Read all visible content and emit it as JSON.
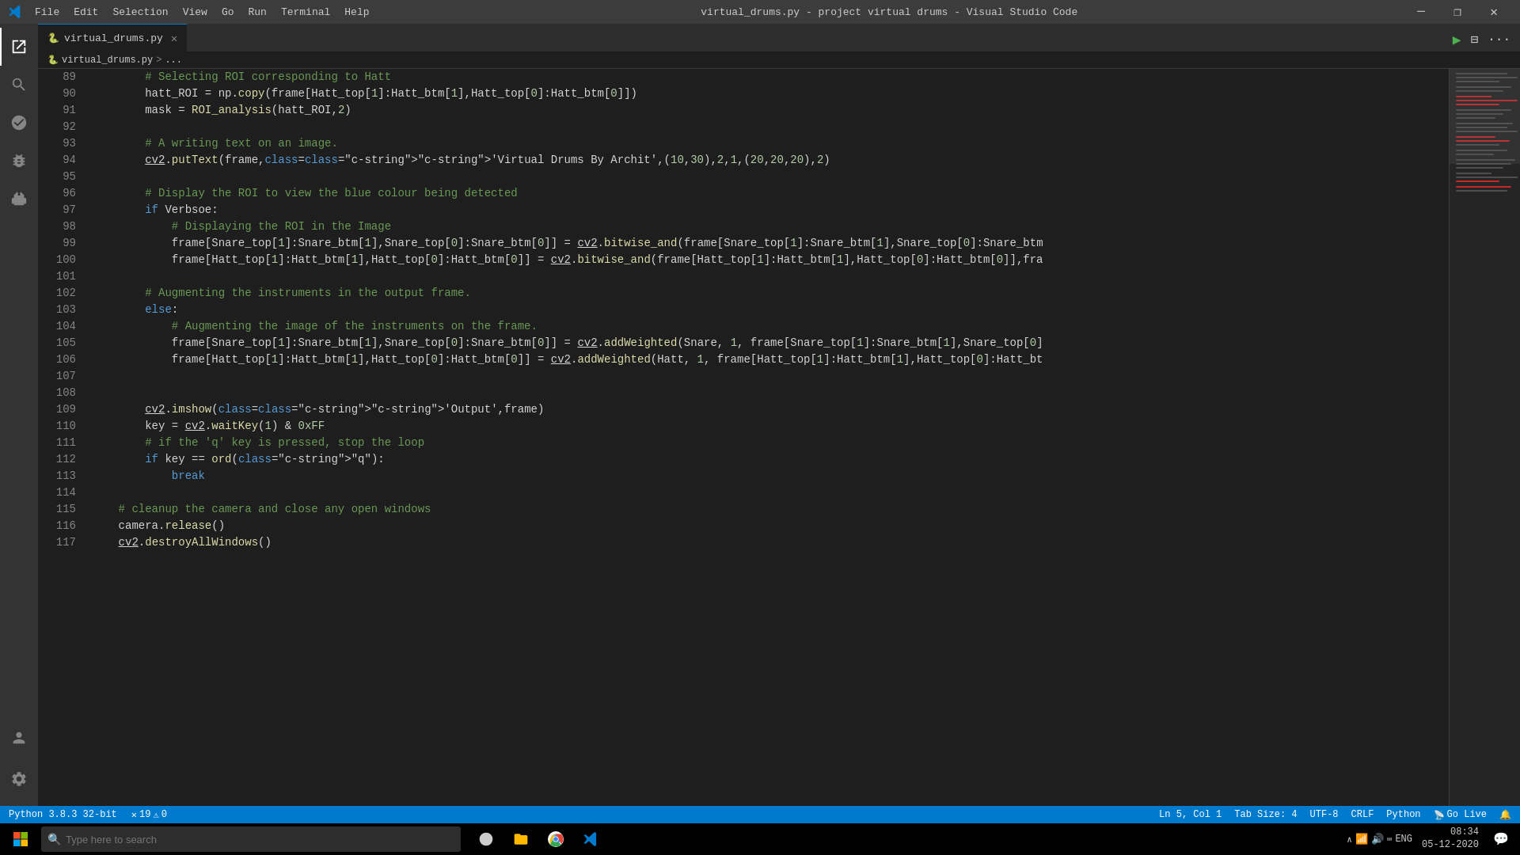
{
  "titlebar": {
    "title": "virtual_drums.py - project virtual drums - Visual Studio Code",
    "menu": [
      "File",
      "Edit",
      "Selection",
      "View",
      "Go",
      "Run",
      "Terminal",
      "Help"
    ]
  },
  "tab": {
    "filename": "virtual_drums.py",
    "icon": "🐍"
  },
  "breadcrumb": {
    "file": "virtual_drums.py",
    "sep": ">",
    "location": "..."
  },
  "lines": [
    {
      "num": "89",
      "code": "        # Selecting ROI corresponding to Hatt"
    },
    {
      "num": "90",
      "code": "        hatt_ROI = np.copy(frame[Hatt_top[1]:Hatt_btm[1],Hatt_top[0]:Hatt_btm[0]])"
    },
    {
      "num": "91",
      "code": "        mask = ROI_analysis(hatt_ROI,2)"
    },
    {
      "num": "92",
      "code": ""
    },
    {
      "num": "93",
      "code": "        # A writing text on an image."
    },
    {
      "num": "94",
      "code": "        cv2.putText(frame,'Virtual Drums By Archit',(10,30),2,1,(20,20,20),2)"
    },
    {
      "num": "95",
      "code": ""
    },
    {
      "num": "96",
      "code": "        # Display the ROI to view the blue colour being detected"
    },
    {
      "num": "97",
      "code": "        if Verbsoe:"
    },
    {
      "num": "98",
      "code": "            # Displaying the ROI in the Image"
    },
    {
      "num": "99",
      "code": "            frame[Snare_top[1]:Snare_btm[1],Snare_top[0]:Snare_btm[0]] = cv2.bitwise_and(frame[Snare_top[1]:Snare_btm[1],Snare_top[0]:Snare_btm"
    },
    {
      "num": "100",
      "code": "            frame[Hatt_top[1]:Hatt_btm[1],Hatt_top[0]:Hatt_btm[0]] = cv2.bitwise_and(frame[Hatt_top[1]:Hatt_btm[1],Hatt_top[0]:Hatt_btm[0]],fra"
    },
    {
      "num": "101",
      "code": ""
    },
    {
      "num": "102",
      "code": "        # Augmenting the instruments in the output frame."
    },
    {
      "num": "103",
      "code": "        else:"
    },
    {
      "num": "104",
      "code": "            # Augmenting the image of the instruments on the frame."
    },
    {
      "num": "105",
      "code": "            frame[Snare_top[1]:Snare_btm[1],Snare_top[0]:Snare_btm[0]] = cv2.addWeighted(Snare, 1, frame[Snare_top[1]:Snare_btm[1],Snare_top[0]"
    },
    {
      "num": "106",
      "code": "            frame[Hatt_top[1]:Hatt_btm[1],Hatt_top[0]:Hatt_btm[0]] = cv2.addWeighted(Hatt, 1, frame[Hatt_top[1]:Hatt_btm[1],Hatt_top[0]:Hatt_bt"
    },
    {
      "num": "107",
      "code": ""
    },
    {
      "num": "108",
      "code": ""
    },
    {
      "num": "109",
      "code": "        cv2.imshow('Output',frame)"
    },
    {
      "num": "110",
      "code": "        key = cv2.waitKey(1) & 0xFF"
    },
    {
      "num": "111",
      "code": "        # if the 'q' key is pressed, stop the loop"
    },
    {
      "num": "112",
      "code": "        if key == ord(\"q\"):"
    },
    {
      "num": "113",
      "code": "            break"
    },
    {
      "num": "114",
      "code": ""
    },
    {
      "num": "115",
      "code": "    # cleanup the camera and close any open windows"
    },
    {
      "num": "116",
      "code": "    camera.release()"
    },
    {
      "num": "117",
      "code": "    cv2.destroyAllWindows()"
    }
  ],
  "statusbar": {
    "python_version": "Python 3.8.3 32-bit",
    "errors": "19",
    "warnings": "0",
    "cursor": "Ln 5, Col 1",
    "tab_size": "Tab Size: 4",
    "encoding": "UTF-8",
    "line_ending": "CRLF",
    "language": "Python",
    "golive": "Go Live",
    "error_icon": "✕",
    "warning_icon": "⚠"
  },
  "taskbar": {
    "search_placeholder": "Type here to search",
    "time": "08:34",
    "date": "05-12-2020"
  },
  "activity": {
    "icons": [
      "files",
      "search",
      "git",
      "debug",
      "extensions"
    ]
  }
}
